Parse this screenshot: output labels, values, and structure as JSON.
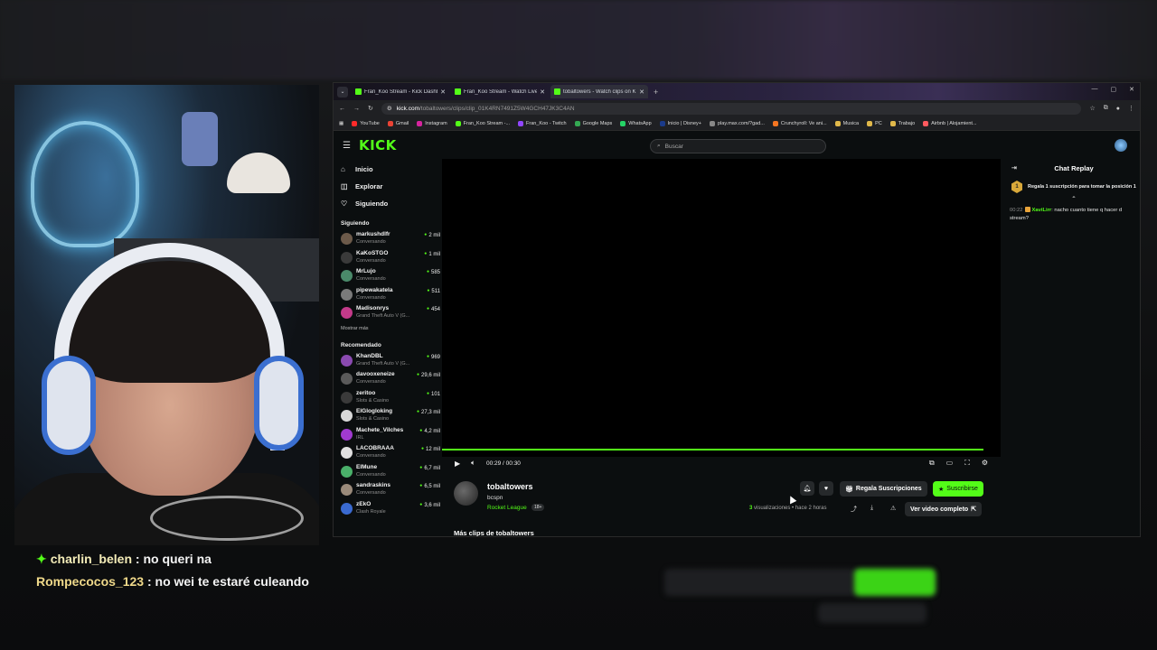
{
  "browser": {
    "tabs": [
      {
        "label": "Fran_Koo Stream - Kick Dashbo"
      },
      {
        "label": "Fran_Koo Stream - Watch Live"
      },
      {
        "label": "tobaltowers - Watch clips on K"
      }
    ],
    "url_site": "kick.com",
    "url_path": "/tobaltowers/clips/clip_01K4RN7491Z5W4GCH47JK3C4AN",
    "bookmarks": [
      "YouTube",
      "Gmail",
      "Instagram",
      "Fran_Koo Stream -...",
      "Fran_Koo - Twitch",
      "Google Maps",
      "WhatsApp",
      "Inicio | Disney+",
      "play.max.com/?gad...",
      "Crunchyroll: Ve ani...",
      "Musica",
      "PC",
      "Trabajo",
      "Airbnb | Alojamient..."
    ]
  },
  "kick": {
    "logo": "KICK",
    "search_placeholder": "Buscar",
    "nav": [
      {
        "label": "Inicio",
        "icon": "home-icon"
      },
      {
        "label": "Explorar",
        "icon": "compass-icon"
      },
      {
        "label": "Siguiendo",
        "icon": "heart-icon"
      }
    ],
    "following_title": "Siguiendo",
    "following": [
      {
        "name": "markushdlfr",
        "category": "Conversando",
        "viewers": "2 mil",
        "color": "#6c5a4a"
      },
      {
        "name": "KaKoSTGO",
        "category": "Conversando",
        "viewers": "1 mil",
        "color": "#3a3a3a"
      },
      {
        "name": "MrLujo",
        "category": "Conversando",
        "viewers": "585",
        "color": "#4a8a6a"
      },
      {
        "name": "pipewakatela",
        "category": "Conversando",
        "viewers": "511",
        "color": "#7a7a7a"
      },
      {
        "name": "Madisonrys",
        "category": "Grand Theft Auto V (G...",
        "viewers": "454",
        "color": "#c43a8a"
      }
    ],
    "show_more": "Mostrar más",
    "recommended_title": "Recomendado",
    "recommended": [
      {
        "name": "KhanDBL",
        "category": "Grand Theft Auto V (G...",
        "viewers": "969",
        "color": "#8a4ab0"
      },
      {
        "name": "davooxeneize",
        "category": "Conversando",
        "viewers": "29,6 mil",
        "color": "#5a5a5a"
      },
      {
        "name": "zeritoo",
        "category": "Slots & Casino",
        "viewers": "101",
        "color": "#3a3a3a"
      },
      {
        "name": "ElGlogloking",
        "category": "Slots & Casino",
        "viewers": "27,3 mil",
        "color": "#d8d8d8"
      },
      {
        "name": "Machete_Vilches",
        "category": "IRL",
        "viewers": "4,2 mil",
        "color": "#a03ad0"
      },
      {
        "name": "LACOBRAAA",
        "category": "Conversando",
        "viewers": "12 mil",
        "color": "#e0e0e0"
      },
      {
        "name": "ElMune",
        "category": "Conversando",
        "viewers": "6,7 mil",
        "color": "#4ab06a"
      },
      {
        "name": "sandraskins",
        "category": "Conversando",
        "viewers": "6,5 mil",
        "color": "#9a8a7a"
      },
      {
        "name": "zEkO",
        "category": "Clash Royale",
        "viewers": "3,6 mil",
        "color": "#3a6ad0"
      }
    ],
    "player": {
      "time": "00:29 / 00:30",
      "progress": 0.97
    },
    "clip": {
      "channel": "tobaltowers",
      "author": "bcspn",
      "category": "Rocket League",
      "age_badge": "18+",
      "gift_label": "Regala Suscripciones",
      "subscribe_label": "Suscribirse",
      "views_count": "3",
      "views_text": "visualizaciones",
      "ago": "hace 2 horas",
      "full_video_label": "Ver video completo",
      "more_clips": "Más clips de tobaltowers"
    },
    "chat": {
      "title": "Chat Replay",
      "pinned": "Regala 1 suscripción para tomar la posición 1",
      "pinned_rank": "1",
      "message": {
        "time": "00:22",
        "user": "XaviLirr",
        "text": "nacho cuanto tiene q hacer d stream?"
      }
    }
  },
  "stream_chat": [
    {
      "user": "charlin_belen",
      "text": "no queri na"
    },
    {
      "user": "Rompecocos_123",
      "text": "no wei te estaré culeando"
    }
  ],
  "colors": {
    "kick_green": "#53fc18",
    "bg": "#0b0e0f"
  }
}
